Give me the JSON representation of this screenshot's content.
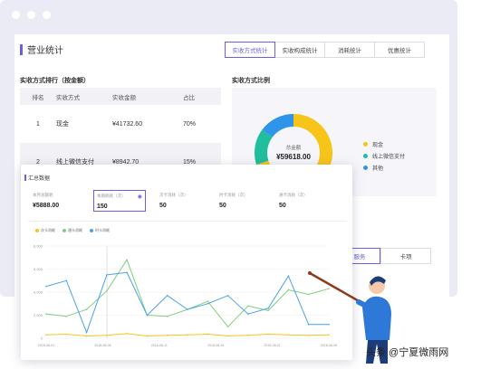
{
  "panel": {
    "title": "营业统计",
    "tabs": [
      "实收方式统计",
      "实收构成统计",
      "消耗统计",
      "优惠统计"
    ],
    "active_tab": 0
  },
  "ranking": {
    "title": "实收方式排行（按金额）",
    "headers": [
      "排名",
      "实收方式",
      "实收金额",
      "占比"
    ],
    "rows": [
      {
        "rank": "1",
        "method": "现金",
        "amount": "¥41732.60",
        "ratio": "70%"
      },
      {
        "rank": "2",
        "method": "线上微信支付",
        "amount": "¥8942.70",
        "ratio": "15%"
      }
    ]
  },
  "ratio_chart": {
    "title": "实收方式比例",
    "center_label": "总金额",
    "center_value": "¥59618.00",
    "legend": [
      {
        "label": "现金",
        "color": "#f7c519"
      },
      {
        "label": "线上微信支付",
        "color": "#1fbe9d"
      },
      {
        "label": "其他",
        "color": "#2f95e8"
      }
    ]
  },
  "bottom_tabs": [
    "服务",
    "卡项"
  ],
  "summary": {
    "title": "汇总数据",
    "metrics": [
      {
        "label": "本月总额耗",
        "value": "¥5888.00"
      },
      {
        "label": "本期耗耗（次）",
        "value": "150"
      },
      {
        "label": "次卡消耗（次）",
        "value": "50"
      },
      {
        "label": "时卡消耗（次）",
        "value": "50"
      },
      {
        "label": "通卡消耗（次）",
        "value": "50"
      }
    ],
    "legend": [
      "次卡消耗",
      "通卡消耗",
      "时卡消耗"
    ]
  },
  "watermark": "头条 @宁夏微雨网",
  "chart_data": {
    "type": "line",
    "x": [
      "2018-08-01",
      "2018-08-06",
      "2018-08-11",
      "2018-08-16",
      "2018-08-21",
      "2018-08-26"
    ],
    "y_ticks": [
      "8,000",
      "6,000",
      "4,000",
      "2,000",
      "0"
    ],
    "ylim": [
      0,
      8000
    ],
    "series": [
      {
        "name": "次卡消耗",
        "color": "#f7c519",
        "values": [
          300,
          350,
          200,
          250,
          400,
          200,
          250,
          300,
          350,
          200,
          250,
          350,
          300,
          250,
          300
        ]
      },
      {
        "name": "通卡消耗",
        "color": "#7ed07e",
        "values": [
          2100,
          1900,
          2500,
          4100,
          6800,
          2000,
          1900,
          2500,
          3200,
          1000,
          2800,
          2400,
          4200,
          3800,
          4300
        ]
      },
      {
        "name": "时卡消耗",
        "color": "#4aa3e8",
        "values": [
          4500,
          5000,
          500,
          5500,
          5700,
          2000,
          3700,
          2500,
          3000,
          3700,
          2100,
          2600,
          5400,
          1200,
          1200
        ]
      }
    ]
  }
}
